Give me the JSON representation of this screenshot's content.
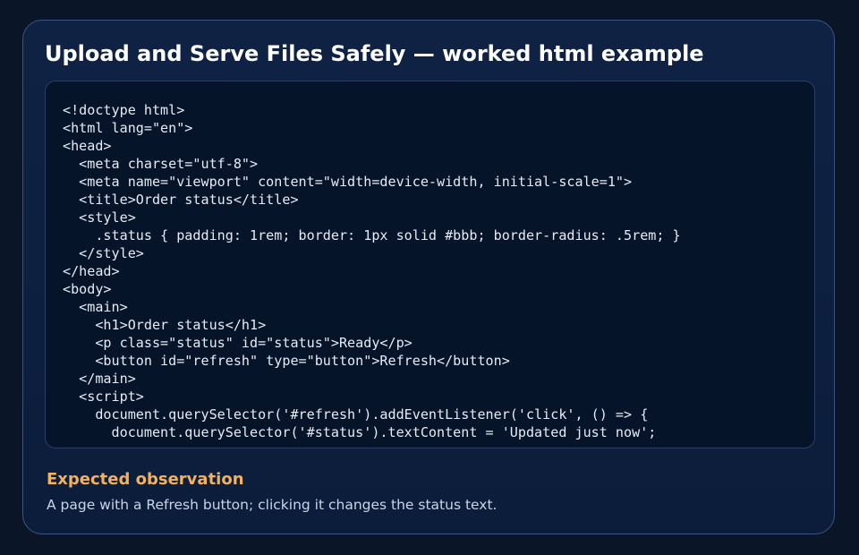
{
  "card": {
    "title": "Upload and Serve Files Safely — worked html example"
  },
  "code": {
    "language": "html",
    "text": "<!doctype html>\n<html lang=\"en\">\n<head>\n  <meta charset=\"utf-8\">\n  <meta name=\"viewport\" content=\"width=device-width, initial-scale=1\">\n  <title>Order status</title>\n  <style>\n    .status { padding: 1rem; border: 1px solid #bbb; border-radius: .5rem; }\n  </style>\n</head>\n<body>\n  <main>\n    <h1>Order status</h1>\n    <p class=\"status\" id=\"status\">Ready</p>\n    <button id=\"refresh\" type=\"button\">Refresh</button>\n  </main>\n  <script>\n    document.querySelector('#refresh').addEventListener('click', () => {\n      document.querySelector('#status').textContent = 'Updated just now';"
  },
  "observation": {
    "heading": "Expected observation",
    "text": "A page with a Refresh button; clicking it changes the status text."
  },
  "colors": {
    "background": "#0b1528",
    "card": "#0f2244",
    "card_border": "#3a5584",
    "code_background": "#06142a",
    "heading_accent": "#f2b15c",
    "title_text": "#ffffff"
  }
}
